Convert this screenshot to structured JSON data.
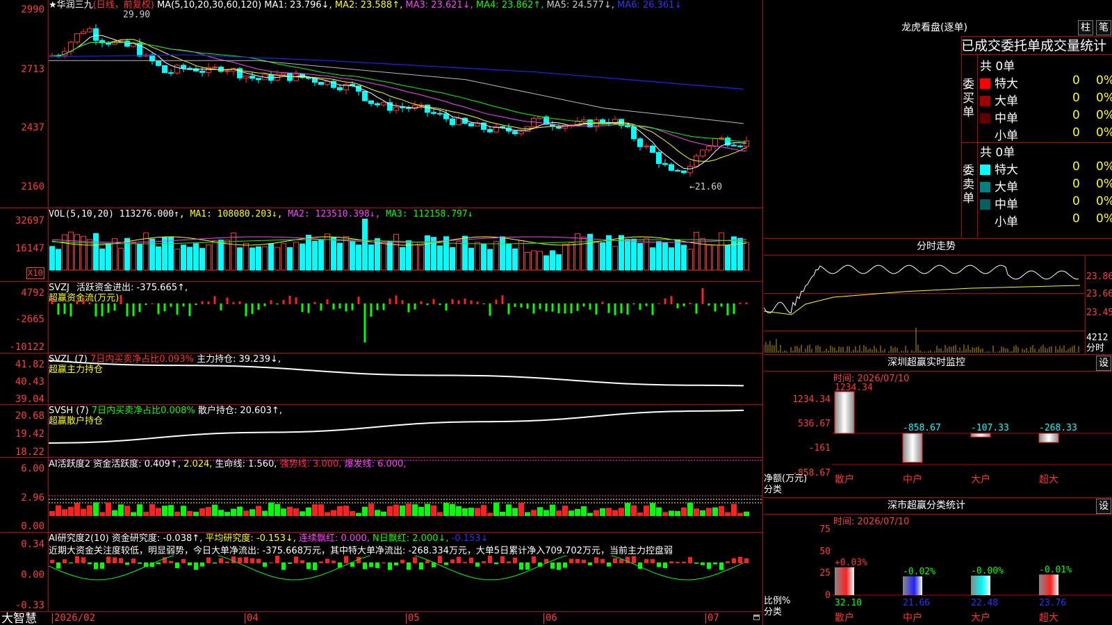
{
  "kline_header": {
    "star": "★",
    "stock_name": "华润三九",
    "period": "(日线，前复权)",
    "ma_params": "MA(5,10,20,30,60,120)",
    "ma1": "MA1: 23.796↓,",
    "ma2": "MA2: 23.588↑,",
    "ma3": "MA3: 23.621↓,",
    "ma4": "MA4: 23.862↑,",
    "ma5": "MA5: 24.577↓,",
    "ma6": "MA6: 26.361↓",
    "high_mark": "29.90",
    "low_mark": "←21.60",
    "axis": [
      "2990",
      "2713",
      "2437",
      "2160"
    ]
  },
  "vol_panel": {
    "label": "VOL(5,10,20)",
    "vol": "113276.000↑,",
    "ma1": "MA1: 108080.203↓,",
    "ma2": "MA2: 123510.398↓,",
    "ma3": "MA3: 112158.797↓",
    "axis": [
      "32697",
      "16147"
    ],
    "unit": "X10"
  },
  "svzj_panel": {
    "label": "SVZJ",
    "active_flow": "活跃资金进出: -375.665↑,",
    "sub": "超赢资金流(万元)",
    "axis": [
      "4792",
      "-2665",
      "-10122"
    ]
  },
  "svzl_panel": {
    "label": "SVZL (7)",
    "ratio": "7日内买卖净占比0.093%",
    "hold": "主力持仓: 39.239↓,",
    "sub": "超赢主力持仓",
    "axis": [
      "41.82",
      "40.43",
      "39.04"
    ]
  },
  "svsh_panel": {
    "label": "SVSH (7)",
    "ratio": "7日内买卖净占比0.008%",
    "hold": "散户持仓: 20.603↑,",
    "sub": "超赢散户持仓",
    "axis": [
      "20.68",
      "19.42",
      "18.22"
    ]
  },
  "ai_active_panel": {
    "label": "AI活跃度2",
    "active": "资金活跃度: 0.409↑,",
    "v2": "2.024,",
    "life": "生命线: 1.560,",
    "strong": "强势线: 3.000,",
    "burst": "爆发线: 6.000,",
    "axis": [
      "6.00",
      "2.96",
      "0.00"
    ]
  },
  "ai_research_panel": {
    "label": "AI研究度2(10)",
    "research": "资金研究度: -0.038↑,",
    "avg": "平均研究度: -0.153↓,",
    "red": "连续飘红: 0.000,",
    "nred": "N日飘红: 2.000↓,",
    "last": "-0.153↓",
    "comment": "近期大资金关注度较低，明显弱势，今日大单净流出: -375.668万元，其中特大单净流出: -268.334万元，大单5日累计净入709.702万元，当前主力控盘弱",
    "axis": [
      "0.34",
      "0.00",
      "-0.33"
    ]
  },
  "time_axis": {
    "brand": "大智慧",
    "labels": [
      "2026/02",
      "04",
      "05",
      "06",
      "07"
    ]
  },
  "dragon": {
    "title": "龙虎看盘(逐单)",
    "btn1": "柱",
    "btn2": "笔",
    "header": "已成交委托单成交量统计",
    "buy_label": "委买单",
    "sell_label": "委卖单",
    "buy_total": "共 0单",
    "sell_total": "共 0单",
    "buy_rows": [
      {
        "name": "特大",
        "count": "0",
        "pct": "0%",
        "color": "#ff0000"
      },
      {
        "name": "大单",
        "count": "0",
        "pct": "0%",
        "color": "#a00000"
      },
      {
        "name": "中单",
        "count": "0",
        "pct": "0%",
        "color": "#600000"
      },
      {
        "name": "小单",
        "count": "0",
        "pct": "0%",
        "color": ""
      }
    ],
    "sell_rows": [
      {
        "name": "特大",
        "count": "0",
        "pct": "0%",
        "color": "#00ffff"
      },
      {
        "name": "大单",
        "count": "0",
        "pct": "0%",
        "color": "#008080"
      },
      {
        "name": "中单",
        "count": "0",
        "pct": "0%",
        "color": "#006060"
      },
      {
        "name": "小单",
        "count": "0",
        "pct": "0%",
        "color": ""
      }
    ]
  },
  "intraday": {
    "title": "分时走势",
    "axis": [
      "23.86",
      "23.66",
      "23.45"
    ],
    "vol_max": "4212",
    "unit": "分时"
  },
  "sz_monitor": {
    "title": "深圳超赢实时监控",
    "set": "设",
    "time": "时间: 2026/07/10",
    "axis": [
      "1234.34",
      "536.67",
      "-161",
      "-858.67"
    ],
    "ylabel1": "净额(万元)",
    "ylabel2": "分类",
    "bars": [
      {
        "name": "散户",
        "value": 1234.34,
        "label": "1234.34"
      },
      {
        "name": "中户",
        "value": -858.67,
        "label": "-858.67"
      },
      {
        "name": "大户",
        "value": -107.33,
        "label": "-107.33"
      },
      {
        "name": "超大",
        "value": -268.33,
        "label": "-268.33"
      }
    ]
  },
  "sz_class": {
    "title": "深市超赢分类统计",
    "set": "设",
    "time": "时间: 2026/07/10",
    "axis": [
      "75",
      "50",
      "25",
      "0"
    ],
    "ylabel1": "比例%",
    "ylabel2": "分类",
    "bars": [
      {
        "name": "散户",
        "value": 32.1,
        "label": "32.10",
        "change": "+0.03%",
        "color": "#ff2020"
      },
      {
        "name": "中户",
        "value": 21.66,
        "label": "21.66",
        "change": "-0.02%",
        "color": "#2020ff"
      },
      {
        "name": "大户",
        "value": 22.48,
        "label": "22.48",
        "change": "-0.00%",
        "color": "#00ffff"
      },
      {
        "name": "超大",
        "value": 23.76,
        "label": "23.76",
        "change": "-0.01%",
        "color": "#ff2020"
      }
    ]
  }
}
